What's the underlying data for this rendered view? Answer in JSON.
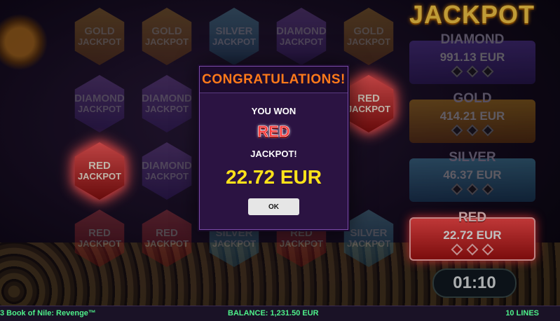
{
  "reels": [
    {
      "type": "gold",
      "line1": "GOLD",
      "line2": "JACKPOT",
      "lit": false
    },
    {
      "type": "gold",
      "line1": "GOLD",
      "line2": "JACKPOT",
      "lit": false
    },
    {
      "type": "silver",
      "line1": "SILVER",
      "line2": "JACKPOT",
      "lit": false
    },
    {
      "type": "diamond",
      "line1": "DIAMOND",
      "line2": "JACKPOT",
      "lit": false
    },
    {
      "type": "gold",
      "line1": "GOLD",
      "line2": "JACKPOT",
      "lit": false
    },
    {
      "type": "diamond",
      "line1": "DIAMOND",
      "line2": "JACKPOT",
      "lit": false
    },
    {
      "type": "diamond",
      "line1": "DIAMOND",
      "line2": "JACKPOT",
      "lit": false
    },
    {
      "type": "red",
      "line1": "RED",
      "line2": "JACKPOT",
      "lit": false
    },
    {
      "type": "red",
      "line1": "RED",
      "line2": "JACKPOT",
      "lit": true
    },
    {
      "type": "red",
      "line1": "RED",
      "line2": "JACKPOT",
      "lit": true
    },
    {
      "type": "diamond",
      "line1": "DIAMOND",
      "line2": "JACKPOT",
      "lit": false
    },
    {
      "type": "diamond",
      "line1": "DIAMOND",
      "line2": "JACKPOT",
      "lit": false
    },
    {
      "type": "red",
      "line1": "RED",
      "line2": "JACKPOT",
      "lit": false
    },
    {
      "type": "red",
      "line1": "RED",
      "line2": "JACKPOT",
      "lit": false
    },
    {
      "type": "red",
      "line1": "RED",
      "line2": "JACKPOT",
      "lit": false
    },
    {
      "type": "silver",
      "line1": "SILVER",
      "line2": "JACKPOT",
      "lit": false
    },
    {
      "type": "silver",
      "line1": "SILVER",
      "line2": "JACKPOT",
      "lit": false
    }
  ],
  "jackpot_panel": {
    "title": "JACKPOT",
    "diamond": {
      "name": "DIAMOND",
      "amount": "991.13 EUR"
    },
    "gold": {
      "name": "GOLD",
      "amount": "414.21 EUR"
    },
    "silver": {
      "name": "SILVER",
      "amount": "46.37 EUR"
    },
    "red": {
      "name": "RED",
      "amount": "22.72 EUR"
    }
  },
  "timer": "01:10",
  "popup": {
    "title": "CONGRATULATIONS!",
    "you_won": "YOU WON",
    "jackpot_type": "RED",
    "jackpot_word": "JACKPOT!",
    "amount": "22.72 EUR",
    "ok_label": "OK"
  },
  "status_bar": {
    "game_name": "3 Book of Nile: Revenge™",
    "balance": "BALANCE: 1,231.50 EUR",
    "lines": "10 LINES"
  },
  "colors": {
    "popup_title": "#ff7a1a",
    "win_amount": "#ffe21a",
    "status_text": "#4ef08a",
    "red_jackpot": "#ff3b3b"
  }
}
